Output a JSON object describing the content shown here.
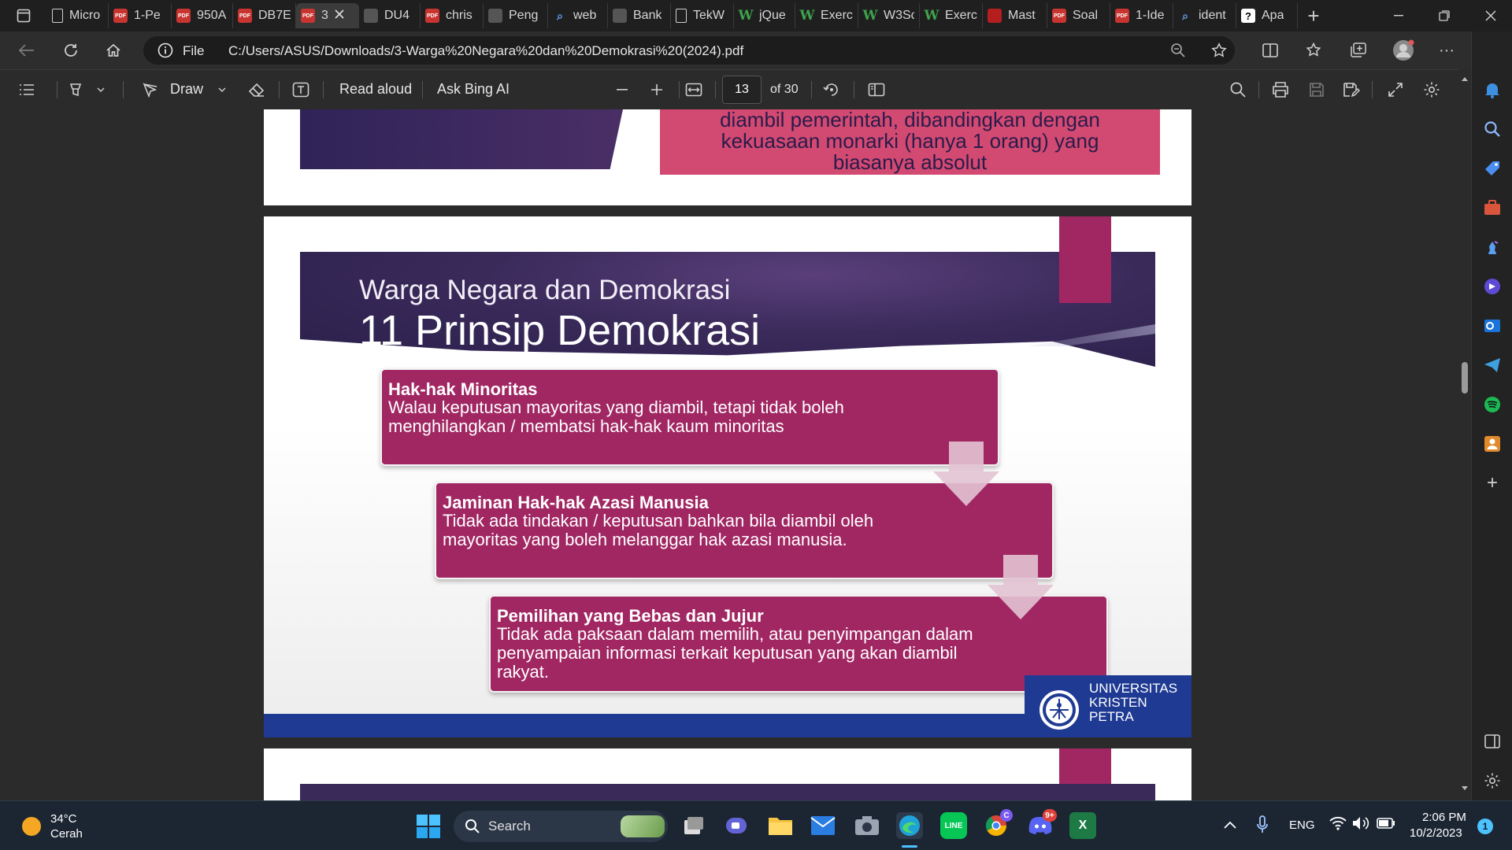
{
  "tabs": [
    {
      "label": "Micro",
      "icon": "doc"
    },
    {
      "label": "1-Pe",
      "icon": "pdf"
    },
    {
      "label": "950A",
      "icon": "pdf"
    },
    {
      "label": "DB7E",
      "icon": "pdf"
    },
    {
      "label": "3",
      "icon": "pdf",
      "active": true
    },
    {
      "label": "DU4",
      "icon": "img"
    },
    {
      "label": "chris",
      "icon": "pdf"
    },
    {
      "label": "Peng",
      "icon": "img"
    },
    {
      "label": "web",
      "icon": "srch"
    },
    {
      "label": "Bank",
      "icon": "img"
    },
    {
      "label": "TekW",
      "icon": "doc"
    },
    {
      "label": "jQue",
      "icon": "w"
    },
    {
      "label": "Exerc",
      "icon": "w"
    },
    {
      "label": "W3Sc",
      "icon": "w"
    },
    {
      "label": "Exerc",
      "icon": "w"
    },
    {
      "label": "Mast",
      "icon": "yt"
    },
    {
      "label": "Soal",
      "icon": "pdf"
    },
    {
      "label": "1-Ide",
      "icon": "pdf"
    },
    {
      "label": "ident",
      "icon": "srch"
    },
    {
      "label": "Apa",
      "icon": "q"
    }
  ],
  "address": {
    "file_label": "File",
    "url": "C:/Users/ASUS/Downloads/3-Warga%20Negara%20dan%20Demokrasi%20(2024).pdf"
  },
  "pdf_toolbar": {
    "draw_label": "Draw",
    "read_aloud_label": "Read aloud",
    "ask_bing_label": "Ask Bing AI",
    "page_current": "13",
    "page_total": "of 30"
  },
  "prev_slide": {
    "text_lines": [
      "diambil pemerintah, dibandingkan dengan",
      "kekuasaan monarki (hanya 1 orang) yang",
      "biasanya absolut"
    ]
  },
  "slide": {
    "subtitle": "Warga Negara dan Demokrasi",
    "title": "11 Prinsip Demokrasi",
    "boxes": [
      {
        "title": "Hak-hak Minoritas",
        "body": "Walau keputusan mayoritas yang diambil, tetapi tidak boleh menghilangkan / membatsi hak-hak kaum minoritas"
      },
      {
        "title": "Jaminan Hak-hak Azasi Manusia",
        "body": "Tidak ada tindakan / keputusan bahkan bila diambil oleh mayoritas yang boleh melanggar hak azasi manusia."
      },
      {
        "title": "Pemilihan yang Bebas dan Jujur",
        "body": "Tidak ada paksaan dalam memilih, atau penyimpangan dalam penyampaian informasi terkait keputusan yang akan diambil rakyat."
      }
    ],
    "logo_lines": [
      "UNIVERSITAS",
      "KRISTEN",
      "PETRA"
    ]
  },
  "taskbar": {
    "weather_temp": "34°C",
    "weather_desc": "Cerah",
    "search_label": "Search",
    "lang": "ENG",
    "time": "2:06 PM",
    "date": "10/2/2023",
    "notif_count": "1",
    "chrome_badge": "C",
    "discord_badge": "9+"
  },
  "colors": {
    "slide_magenta": "#a12763",
    "slide_header": "#3a2a5a",
    "footer_blue": "#1f3a93",
    "prev_box": "#d24a72"
  }
}
